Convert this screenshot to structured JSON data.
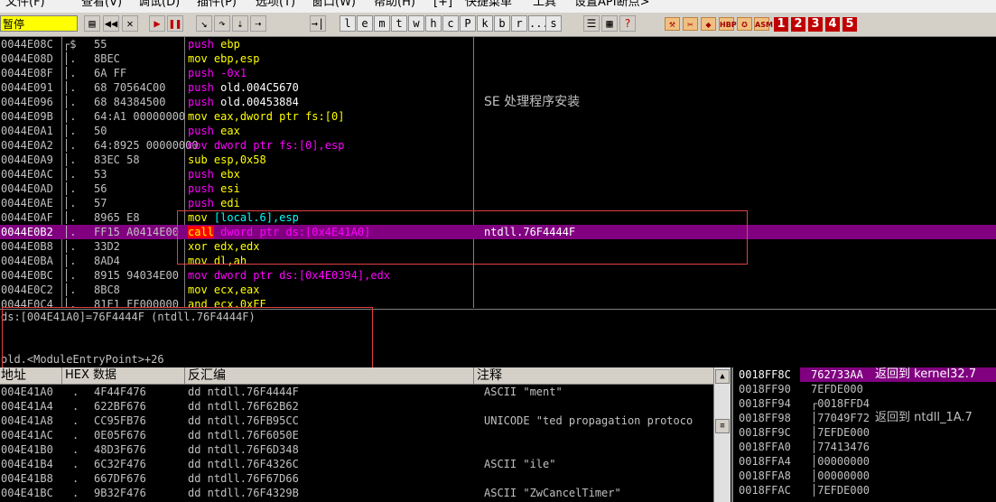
{
  "menu": [
    "文件(F)",
    "查看(V)",
    "调试(D)",
    "插件(P)",
    "选项(T)",
    "窗口(W)",
    "帮助(H)",
    "[+]",
    "快捷菜单",
    "工具",
    "设置API断点>"
  ],
  "status": "暂停",
  "toolbar": {
    "letters": [
      "l",
      "e",
      "m",
      "t",
      "w",
      "h",
      "c",
      "P",
      "k",
      "b",
      "r",
      "...",
      "s"
    ],
    "numbers": [
      "1",
      "2",
      "3",
      "4",
      "5"
    ],
    "icons": [
      "HBP",
      "ASM"
    ]
  },
  "disasm": [
    {
      "addr": "0044E08C",
      "mark": "┌$",
      "hex": "55",
      "mn": "push",
      "ops": "ebp",
      "color": "#ff00ff",
      "opcolor": "#ffff00",
      "cmt": ""
    },
    {
      "addr": "0044E08D",
      "mark": "│.",
      "hex": "8BEC",
      "mn": "mov",
      "ops": "ebp,esp",
      "color": "#ffff00",
      "opcolor": "#ffff00",
      "cmt": ""
    },
    {
      "addr": "0044E08F",
      "mark": "│.",
      "hex": "6A FF",
      "mn": "push",
      "ops": "-0x1",
      "color": "#ff00ff",
      "opcolor": "#ff00ff",
      "cmt": ""
    },
    {
      "addr": "0044E091",
      "mark": "│.",
      "hex": "68 70564C00",
      "mn": "push",
      "ops": "old.004C5670",
      "color": "#ff00ff",
      "opcolor": "#ffffff",
      "cmt": ""
    },
    {
      "addr": "0044E096",
      "mark": "│.",
      "hex": "68 84384500",
      "mn": "push",
      "ops": "old.00453884",
      "color": "#ff00ff",
      "opcolor": "#ffffff",
      "cmt": "SE 处理程序安装"
    },
    {
      "addr": "0044E09B",
      "mark": "│.",
      "hex": "64:A1 00000000",
      "mn": "mov",
      "ops": "eax,dword ptr fs:[0]",
      "color": "#ffff00",
      "opcolor": "#ffff00",
      "cmt": ""
    },
    {
      "addr": "0044E0A1",
      "mark": "│.",
      "hex": "50",
      "mn": "push",
      "ops": "eax",
      "color": "#ff00ff",
      "opcolor": "#ffff00",
      "cmt": ""
    },
    {
      "addr": "0044E0A2",
      "mark": "│.",
      "hex": "64:8925 00000000",
      "mn": "mov",
      "ops": "dword ptr fs:[0],esp",
      "color": "#ff00ff",
      "opcolor": "#ff00ff",
      "cmt": ""
    },
    {
      "addr": "0044E0A9",
      "mark": "│.",
      "hex": "83EC 58",
      "mn": "sub",
      "ops": "esp,0x58",
      "color": "#ffff00",
      "opcolor": "#ffff00",
      "cmt": ""
    },
    {
      "addr": "0044E0AC",
      "mark": "│.",
      "hex": "53",
      "mn": "push",
      "ops": "ebx",
      "color": "#ff00ff",
      "opcolor": "#ffff00",
      "cmt": ""
    },
    {
      "addr": "0044E0AD",
      "mark": "│.",
      "hex": "56",
      "mn": "push",
      "ops": "esi",
      "color": "#ff00ff",
      "opcolor": "#ffff00",
      "cmt": ""
    },
    {
      "addr": "0044E0AE",
      "mark": "│.",
      "hex": "57",
      "mn": "push",
      "ops": "edi",
      "color": "#ff00ff",
      "opcolor": "#ffff00",
      "cmt": ""
    },
    {
      "addr": "0044E0AF",
      "mark": "│.",
      "hex": "8965 E8",
      "mn": "mov",
      "ops": "[local.6],esp",
      "color": "#ffff00",
      "opcolor": "#00ffff",
      "cmt": ""
    },
    {
      "addr": "0044E0B2",
      "mark": "│.",
      "hex": "FF15 A0414E00",
      "mn": "call",
      "ops": "dword ptr ds:[0x4E41A0]",
      "color": "#ffff00",
      "opcolor": "#ff00ff",
      "cmt": "ntdll.76F4444F",
      "selected": true
    },
    {
      "addr": "0044E0B8",
      "mark": "│.",
      "hex": "33D2",
      "mn": "xor",
      "ops": "edx,edx",
      "color": "#ffff00",
      "opcolor": "#ffff00",
      "cmt": ""
    },
    {
      "addr": "0044E0BA",
      "mark": "│.",
      "hex": "8AD4",
      "mn": "mov",
      "ops": "dl,ah",
      "color": "#ffff00",
      "opcolor": "#ffff00",
      "cmt": ""
    },
    {
      "addr": "0044E0BC",
      "mark": "│.",
      "hex": "8915 94034E00",
      "mn": "mov",
      "ops": "dword ptr ds:[0x4E0394],edx",
      "color": "#ff00ff",
      "opcolor": "#ff00ff",
      "cmt": ""
    },
    {
      "addr": "0044E0C2",
      "mark": "│.",
      "hex": "8BC8",
      "mn": "mov",
      "ops": "ecx,eax",
      "color": "#ffff00",
      "opcolor": "#ffff00",
      "cmt": ""
    },
    {
      "addr": "0044E0C4",
      "mark": "│.",
      "hex": "81E1 FF000000",
      "mn": "and",
      "ops": "ecx,0xFF",
      "color": "#ffff00",
      "opcolor": "#ffff00",
      "cmt": ""
    }
  ],
  "info": {
    "line1": "ds:[004E41A0]=76F4444F (ntdll.76F4444F)",
    "line2": "old.<ModuleEntryPoint>+26"
  },
  "dump_headers": {
    "addr": "地址",
    "hex": "HEX 数据",
    "disasm": "反汇编",
    "comment": "注释"
  },
  "dump": [
    {
      "addr": "004E41A0",
      "hex": "4F44F476",
      "dis": "dd ntdll.76F4444F",
      "cmt": "ASCII \"ment\""
    },
    {
      "addr": "004E41A4",
      "hex": "622BF676",
      "dis": "dd ntdll.76F62B62",
      "cmt": ""
    },
    {
      "addr": "004E41A8",
      "hex": "CC95FB76",
      "dis": "dd ntdll.76FB95CC",
      "cmt": "UNICODE \"ted propagation protoco"
    },
    {
      "addr": "004E41AC",
      "hex": "0E05F676",
      "dis": "dd ntdll.76F6050E",
      "cmt": ""
    },
    {
      "addr": "004E41B0",
      "hex": "48D3F676",
      "dis": "dd ntdll.76F6D348",
      "cmt": ""
    },
    {
      "addr": "004E41B4",
      "hex": "6C32F476",
      "dis": "dd ntdll.76F4326C",
      "cmt": "ASCII \"ile\""
    },
    {
      "addr": "004E41B8",
      "hex": "667DF676",
      "dis": "dd ntdll.76F67D66",
      "cmt": ""
    },
    {
      "addr": "004E41BC",
      "hex": "9B32F476",
      "dis": "dd ntdll.76F4329B",
      "cmt": "ASCII \"ZwCancelTimer\""
    }
  ],
  "stack": [
    {
      "addr": "0018FF8C",
      "val": "762733AA",
      "cmt": "返回到 kernel32.7",
      "top": true
    },
    {
      "addr": "0018FF90",
      "val": "7EFDE000",
      "cmt": ""
    },
    {
      "addr": "0018FF94",
      "val": "┌0018FFD4",
      "cmt": ""
    },
    {
      "addr": "0018FF98",
      "val": "│77049F72",
      "cmt": "返回到 ntdll_1A.7"
    },
    {
      "addr": "0018FF9C",
      "val": "│7EFDE000",
      "cmt": ""
    },
    {
      "addr": "0018FFA0",
      "val": "│77413476",
      "cmt": ""
    },
    {
      "addr": "0018FFA4",
      "val": "│00000000",
      "cmt": ""
    },
    {
      "addr": "0018FFA8",
      "val": "│00000000",
      "cmt": ""
    },
    {
      "addr": "0018FFAC",
      "val": "│7EFDE000",
      "cmt": ""
    }
  ]
}
